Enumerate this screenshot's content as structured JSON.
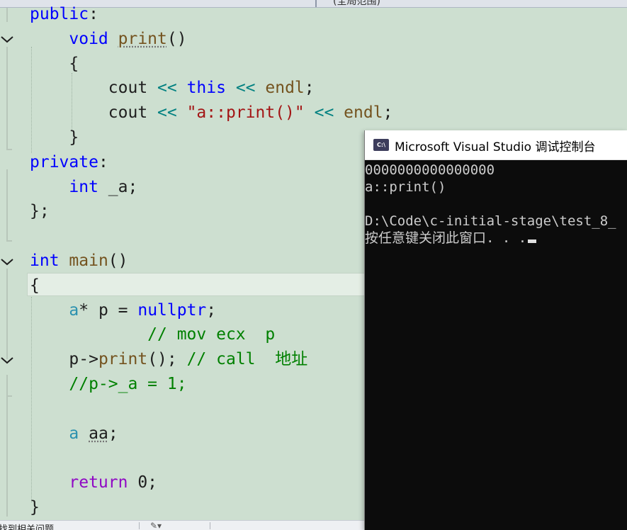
{
  "top_bar": {
    "scope_label": "(全局范围)"
  },
  "code": {
    "lines": [
      {
        "id": "l-public",
        "tokens": [
          [
            "kw",
            "public"
          ],
          [
            "plain",
            ":"
          ]
        ]
      },
      {
        "id": "l-void-print",
        "tokens": [
          [
            "plain",
            "    "
          ],
          [
            "kw",
            "void"
          ],
          [
            "plain",
            " "
          ],
          [
            "fn-squig",
            "print"
          ],
          [
            "plain",
            "()"
          ]
        ]
      },
      {
        "id": "l-open-brace1",
        "tokens": [
          [
            "plain",
            "    {"
          ]
        ]
      },
      {
        "id": "l-cout-this",
        "tokens": [
          [
            "plain",
            "        cout "
          ],
          [
            "op",
            "<<"
          ],
          [
            "plain",
            " "
          ],
          [
            "kw",
            "this"
          ],
          [
            "plain",
            " "
          ],
          [
            "op",
            "<<"
          ],
          [
            "plain",
            " "
          ],
          [
            "fn",
            "endl"
          ],
          [
            "plain",
            ";"
          ]
        ]
      },
      {
        "id": "l-cout-str",
        "tokens": [
          [
            "plain",
            "        cout "
          ],
          [
            "op",
            "<<"
          ],
          [
            "plain",
            " "
          ],
          [
            "str",
            "\"a::print()\""
          ],
          [
            "plain",
            " "
          ],
          [
            "op",
            "<<"
          ],
          [
            "plain",
            " "
          ],
          [
            "fn",
            "endl"
          ],
          [
            "plain",
            ";"
          ]
        ]
      },
      {
        "id": "l-close-brace1",
        "tokens": [
          [
            "plain",
            "    }"
          ]
        ]
      },
      {
        "id": "l-private",
        "tokens": [
          [
            "kw",
            "private"
          ],
          [
            "plain",
            ":"
          ]
        ]
      },
      {
        "id": "l-int-a",
        "tokens": [
          [
            "plain",
            "    "
          ],
          [
            "kw",
            "int"
          ],
          [
            "plain",
            " _a;"
          ]
        ]
      },
      {
        "id": "l-class-end",
        "tokens": [
          [
            "plain",
            "};"
          ]
        ]
      },
      {
        "id": "l-blank1",
        "tokens": []
      },
      {
        "id": "l-int-main",
        "tokens": [
          [
            "kw",
            "int"
          ],
          [
            "plain",
            " "
          ],
          [
            "fn",
            "main"
          ],
          [
            "plain",
            "()"
          ]
        ]
      },
      {
        "id": "l-open-brace2",
        "tokens": [
          [
            "plain",
            "{"
          ]
        ]
      },
      {
        "id": "l-ap-null",
        "tokens": [
          [
            "plain",
            "    "
          ],
          [
            "type",
            "a"
          ],
          [
            "plain",
            "* p = "
          ],
          [
            "kw",
            "nullptr"
          ],
          [
            "plain",
            ";"
          ]
        ]
      },
      {
        "id": "l-comment-mov",
        "tokens": [
          [
            "plain",
            "            "
          ],
          [
            "cm",
            "// mov ecx  p"
          ]
        ]
      },
      {
        "id": "l-p-print",
        "tokens": [
          [
            "plain",
            "    p->"
          ],
          [
            "fn",
            "print"
          ],
          [
            "plain",
            "(); "
          ],
          [
            "cm",
            "// call  地址"
          ]
        ]
      },
      {
        "id": "l-comment-pa",
        "tokens": [
          [
            "plain",
            "    "
          ],
          [
            "cm",
            "//p->_a = 1;"
          ]
        ]
      },
      {
        "id": "l-blank2",
        "tokens": []
      },
      {
        "id": "l-a-aa",
        "tokens": [
          [
            "plain",
            "    "
          ],
          [
            "type",
            "a"
          ],
          [
            "plain",
            " "
          ],
          [
            "plain-squig",
            "aa"
          ],
          [
            "plain",
            ";"
          ]
        ]
      },
      {
        "id": "l-blank3",
        "tokens": []
      },
      {
        "id": "l-return",
        "tokens": [
          [
            "plain",
            "    "
          ],
          [
            "ctrl",
            "return"
          ],
          [
            "plain",
            " 0;"
          ]
        ]
      },
      {
        "id": "l-close-brace2",
        "tokens": [
          [
            "plain",
            "}"
          ]
        ]
      }
    ]
  },
  "console": {
    "title": "Microsoft Visual Studio 调试控制台",
    "icon_text": "C:\\",
    "output_lines": [
      "0000000000000000",
      "a::print()",
      "",
      "D:\\Code\\c-initial-stage\\test_8_",
      "按任意键关闭此窗口. . ."
    ]
  },
  "status_bar": {
    "text": "找到相关问题"
  }
}
